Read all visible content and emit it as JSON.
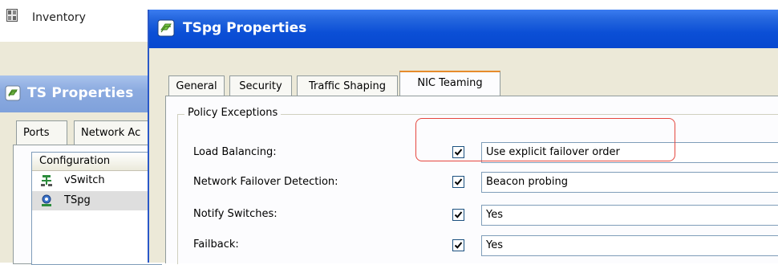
{
  "background": {
    "inventory": {
      "label": "Inventory",
      "icon": "inventory-icon"
    },
    "ts_window": {
      "title": "TS Properties",
      "tabs": [
        {
          "label": "Ports"
        },
        {
          "label": "Network Ac"
        }
      ],
      "list": {
        "header": "Configuration",
        "rows": [
          {
            "label": "vSwitch",
            "icon": "vswitch-icon"
          },
          {
            "label": "TSpg",
            "icon": "portgroup-icon",
            "selected": true
          }
        ]
      }
    }
  },
  "dialog": {
    "title": "TSpg Properties",
    "tabs": [
      {
        "label": "General"
      },
      {
        "label": "Security"
      },
      {
        "label": "Traffic Shaping"
      },
      {
        "label": "NIC Teaming",
        "active": true
      }
    ],
    "group_title": "Policy Exceptions",
    "options": [
      {
        "label": "Load Balancing:",
        "checked": true,
        "value": "Use explicit failover order"
      },
      {
        "label": "Network Failover Detection:",
        "checked": true,
        "value": "Beacon probing"
      },
      {
        "label": "Notify Switches:",
        "checked": true,
        "value": "Yes"
      },
      {
        "label": "Failback:",
        "checked": true,
        "value": "Yes"
      }
    ]
  },
  "colors": {
    "titlebar_active": "#0b4fd6",
    "titlebar_inactive": "#8cabe0",
    "annotation": "#e5473f",
    "active_tab_accent": "#e68b2c"
  }
}
